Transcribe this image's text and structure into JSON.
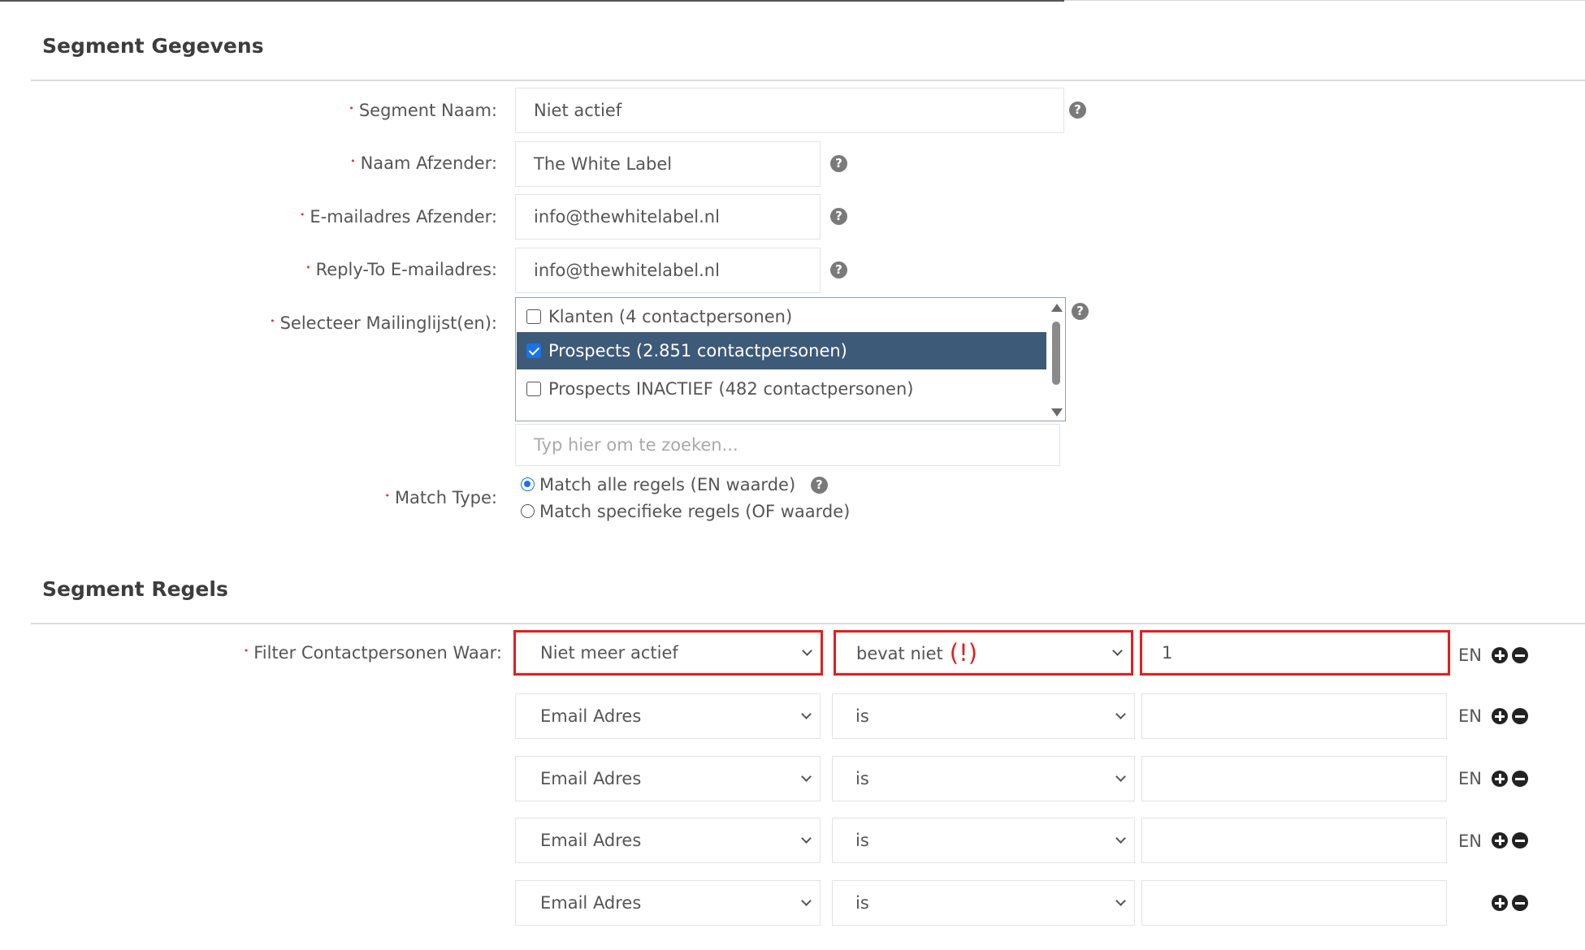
{
  "segment_details": {
    "title": "Segment Gegevens",
    "fields": {
      "segment_name": {
        "label": "Segment Naam:",
        "value": "Niet actief"
      },
      "sender_name": {
        "label": "Naam Afzender:",
        "value": "The White Label"
      },
      "sender_email": {
        "label": "E-mailadres Afzender:",
        "value": "info@thewhitelabel.nl"
      },
      "reply_to": {
        "label": "Reply-To E-mailadres:",
        "value": "info@thewhitelabel.nl"
      }
    },
    "mailing_lists": {
      "label": "Selecteer Mailinglijst(en):",
      "items": [
        {
          "label": "Klanten (4 contactpersonen)",
          "checked": false
        },
        {
          "label": "Prospects (2.851 contactpersonen)",
          "checked": true
        },
        {
          "label": "Prospects INACTIEF (482 contactpersonen)",
          "checked": false
        }
      ],
      "search_placeholder": "Typ hier om te zoeken..."
    },
    "match_type": {
      "label": "Match Type:",
      "options": [
        {
          "label": "Match alle regels (EN waarde)",
          "selected": true
        },
        {
          "label": "Match specifieke regels (OF waarde)",
          "selected": false
        }
      ]
    }
  },
  "segment_rules": {
    "title": "Segment Regels",
    "filter_label": "Filter Contactpersonen Waar:",
    "rules": [
      {
        "field": "Niet meer actief",
        "operator": "bevat niet",
        "value": "1",
        "connector": "EN",
        "highlighted": true,
        "warning": "(!)"
      },
      {
        "field": "Email Adres",
        "operator": "is",
        "value": "",
        "connector": "EN"
      },
      {
        "field": "Email Adres",
        "operator": "is",
        "value": "",
        "connector": "EN"
      },
      {
        "field": "Email Adres",
        "operator": "is",
        "value": "",
        "connector": "EN"
      },
      {
        "field": "Email Adres",
        "operator": "is",
        "value": "",
        "connector": ""
      }
    ]
  },
  "colors": {
    "highlight": "#e41e1e",
    "selected_row": "#3d5a78",
    "required_marker": "#e53935"
  },
  "icons": {
    "help": "question-circle-icon",
    "add": "plus-circle-icon",
    "remove": "minus-circle-icon"
  }
}
